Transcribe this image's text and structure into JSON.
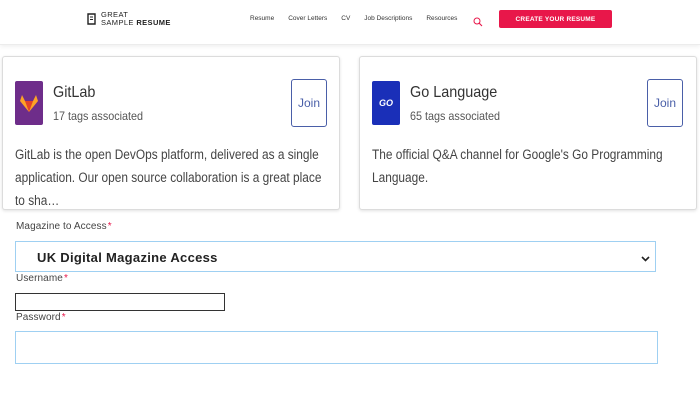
{
  "header": {
    "logo_line1": "GREAT",
    "logo_line2a": "SAMPLE",
    "logo_line2b": "RESUME",
    "nav": [
      "Resume",
      "Cover Letters",
      "CV",
      "Job Descriptions",
      "Resources"
    ],
    "cta_label": "CREATE YOUR RESUME",
    "accent_color": "#e8174a"
  },
  "cards": [
    {
      "title": "GitLab",
      "tags": "17 tags associated",
      "description": "GitLab is the open DevOps platform, delivered as a single application. Our open source collaboration is a great place to sha…",
      "join_label": "Join",
      "logo_color": "#6e2d8a",
      "icon": "gitlab-icon"
    },
    {
      "title": "Go Language",
      "tags": "65 tags associated",
      "description": "The official Q&A channel for Google's Go Programming Language.",
      "join_label": "Join",
      "logo_color": "#1a2fb8",
      "logo_text": "GO",
      "icon": "go-icon"
    }
  ],
  "form": {
    "magazine_label": "Magazine to Access",
    "magazine_value": "UK Digital Magazine Access",
    "username_label": "Username",
    "username_value": "",
    "password_label": "Password",
    "password_value": "",
    "required_mark": "*"
  }
}
